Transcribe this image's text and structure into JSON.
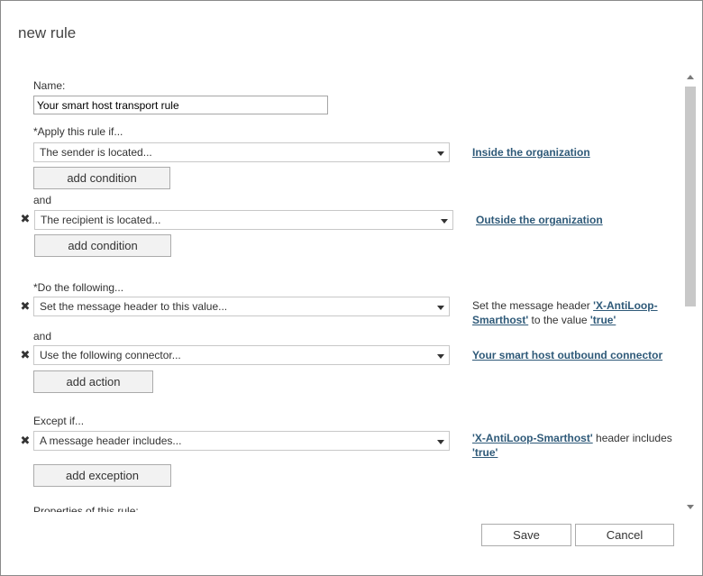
{
  "dialog": {
    "title": "new rule"
  },
  "name_field": {
    "label": "Name:",
    "value": "Your smart host transport rule"
  },
  "apply_section": {
    "label": "*Apply this rule if...",
    "condition1": {
      "value": "The sender is located...",
      "link": "Inside the organization"
    },
    "add_condition_1": "add condition",
    "and_label": "and",
    "condition2": {
      "value": "The recipient is located...",
      "link": "Outside the organization"
    },
    "add_condition_2": "add condition"
  },
  "do_section": {
    "label": "*Do the following...",
    "action1": {
      "value": "Set the message header to this value...",
      "desc_prefix": "Set the message header ",
      "header_link": "'X-AntiLoop-Smarthost'",
      "desc_middle": " to the value ",
      "value_link": "'true'"
    },
    "and_label": "and",
    "action2": {
      "value": "Use the following connector...",
      "link": "Your smart host outbound connector"
    },
    "add_action": "add action"
  },
  "except_section": {
    "label": "Except if...",
    "exception1": {
      "value": "A message header includes...",
      "header_link": "'X-AntiLoop-Smarthost'",
      "desc_middle": " header includes ",
      "value_link": "'true'"
    },
    "add_exception": "add exception"
  },
  "properties": {
    "label": "Properties of this rule:"
  },
  "footer": {
    "save": "Save",
    "cancel": "Cancel"
  },
  "icons": {
    "remove": "close-icon"
  },
  "colors": {
    "link": "#2f5a79",
    "button_bg": "#f2f2f2",
    "border": "#ababab"
  }
}
